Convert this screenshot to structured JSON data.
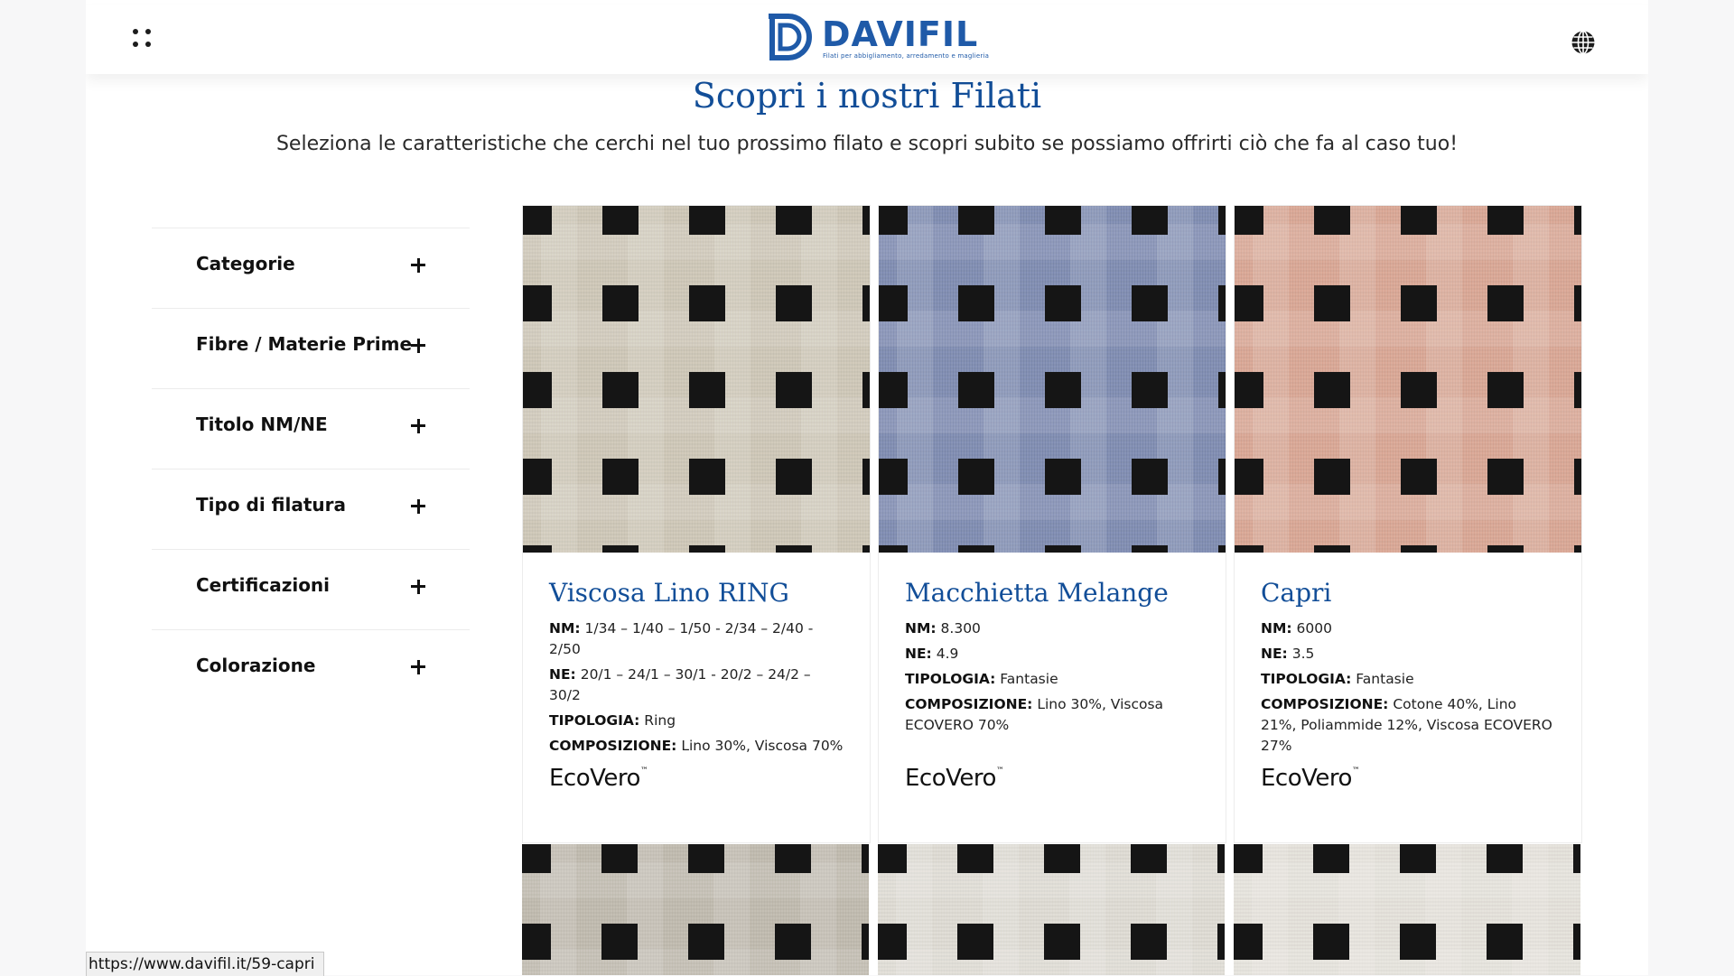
{
  "brand": {
    "name": "DAVIFIL",
    "tagline": "Filati per abbigliamento, arredamento e maglieria",
    "color": "#1f5aa8"
  },
  "header": {
    "menu_icon": "dots-grid-icon",
    "language_icon": "globe-icon"
  },
  "hero": {
    "title": "Scopri i nostri Filati",
    "subtitle": "Seleziona le caratteristiche che cerchi nel tuo prossimo filato e scopri subito se possiamo offrirti ciò che fa al caso tuo!"
  },
  "filters": [
    {
      "label": "Categorie"
    },
    {
      "label": "Fibre / Materie Prime"
    },
    {
      "label": "Titolo NM/NE"
    },
    {
      "label": "Tipo di filatura"
    },
    {
      "label": "Certificazioni"
    },
    {
      "label": "Colorazione"
    }
  ],
  "products": [
    {
      "title": "Viscosa Lino RING",
      "nm_label": "NM:",
      "nm": "1/34 – 1/40 – 1/50 - 2/34 – 2/40 - 2/50",
      "ne_label": "NE:",
      "ne": "20/1 – 24/1 – 30/1 - 20/2 – 24/2 – 30/2",
      "tipologia_label": "TIPOLOGIA:",
      "tipologia": "Ring",
      "composizione_label": "COMPOSIZIONE:",
      "composizione": "Lino 30%, Viscosa 70%",
      "cert_logo": "EcoVero",
      "swatch_color": "#cdc6b6"
    },
    {
      "title": "Macchietta Melange",
      "nm_label": "NM:",
      "nm": "8.300",
      "ne_label": "NE:",
      "ne": "4.9",
      "tipologia_label": "TIPOLOGIA:",
      "tipologia": "Fantasie",
      "composizione_label": "COMPOSIZIONE:",
      "composizione": "Lino 30%, Viscosa ECOVERO 70%",
      "cert_logo": "EcoVero",
      "swatch_color": "#7d8ab0"
    },
    {
      "title": "Capri",
      "nm_label": "NM:",
      "nm": "6000",
      "ne_label": "NE:",
      "ne": "3.5",
      "tipologia_label": "TIPOLOGIA:",
      "tipologia": "Fantasie",
      "composizione_label": "COMPOSIZIONE:",
      "composizione": "Cotone 40%, Lino 21%, Poliammide 12%, Viscosa ECOVERO 27%",
      "cert_logo": "EcoVero",
      "swatch_color": "#d8a593"
    }
  ],
  "status_bar": {
    "url": "https://www.davifil.it/59-capri"
  }
}
